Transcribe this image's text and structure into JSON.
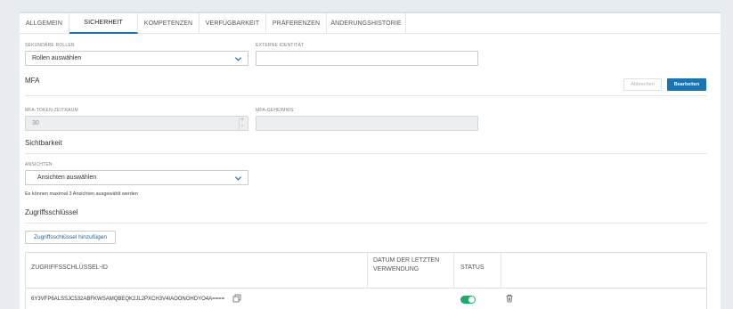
{
  "tabs": [
    {
      "label": "Allgemein",
      "active": false
    },
    {
      "label": "Sicherheit",
      "active": true
    },
    {
      "label": "Kompetenzen",
      "active": false
    },
    {
      "label": "Verfügbarkeit",
      "active": false
    },
    {
      "label": "Präferenzen",
      "active": false
    },
    {
      "label": "Änderungshistorie",
      "active": false
    }
  ],
  "roles": {
    "secondary_label": "Sekundäre Rollen",
    "secondary_value": "Rollen auswählen",
    "external_label": "Externe Identität",
    "external_value": ""
  },
  "mfa": {
    "title": "MFA",
    "cancel_label": "Abbrechen",
    "edit_label": "Bearbeiten",
    "token_label": "MFA-Token-Zeitraum",
    "token_value": "30",
    "secret_label": "MFA-Geheimnis",
    "secret_value": ""
  },
  "visibility": {
    "title": "Sichtbarkeit",
    "views_label": "Ansichten",
    "views_value": "Ansichten auswählen",
    "hint": "Es können maximal 3 Ansichten ausgewählt werden"
  },
  "access_keys": {
    "title": "Zugriffsschlüssel",
    "add_label": "Zugriffsschlüssel hinzufügen",
    "col_id": "Zugriffsschlüssel-ID",
    "col_last_used": "Datum der letzten Verwendung",
    "col_status": "Status",
    "rows": [
      {
        "id": "6Y3VFP6ALSSJC532ABFKWSAMQBEQK2JL2PXCH3V4IAOONOHDYO4A====",
        "last_used": "",
        "status_on": true
      }
    ]
  },
  "colors": {
    "accent": "#1a73b5",
    "toggle_on": "#1faa6b"
  }
}
